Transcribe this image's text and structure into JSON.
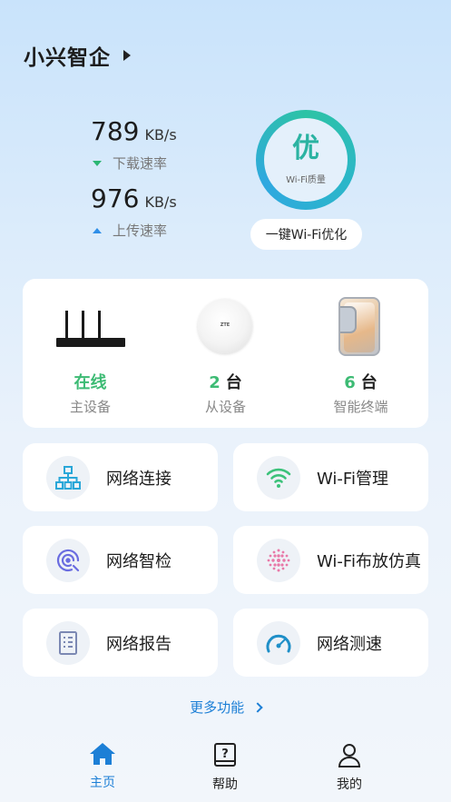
{
  "header": {
    "title": "小兴智企"
  },
  "speed": {
    "download": {
      "value": "789",
      "unit": "KB/s",
      "label": "下载速率"
    },
    "upload": {
      "value": "976",
      "unit": "KB/s",
      "label": "上传速率"
    }
  },
  "quality": {
    "grade": "优",
    "label": "Wi-Fi质量",
    "optimize_label": "一键Wi-Fi优化"
  },
  "devices": {
    "main": {
      "status": "在线",
      "label": "主设备"
    },
    "sub": {
      "count": "2",
      "unit": "台",
      "label": "从设备",
      "logo": "ZTE"
    },
    "terminals": {
      "count": "6",
      "unit": "台",
      "label": "智能终端"
    }
  },
  "functions": [
    {
      "label": "网络连接",
      "icon": "network-topology-icon"
    },
    {
      "label": "Wi-Fi管理",
      "icon": "wifi-icon"
    },
    {
      "label": "网络智检",
      "icon": "network-inspect-icon"
    },
    {
      "label": "Wi-Fi布放仿真",
      "icon": "wifi-simulation-icon"
    },
    {
      "label": "网络报告",
      "icon": "report-icon"
    },
    {
      "label": "网络测速",
      "icon": "speedometer-icon"
    }
  ],
  "more_label": "更多功能",
  "nav": [
    {
      "label": "主页",
      "icon": "home-icon",
      "active": true
    },
    {
      "label": "帮助",
      "icon": "help-book-icon"
    },
    {
      "label": "我的",
      "icon": "user-icon"
    }
  ],
  "colors": {
    "accent": "#1c7fd6",
    "online": "#3dbb74",
    "ring": "#2bb3a2"
  }
}
